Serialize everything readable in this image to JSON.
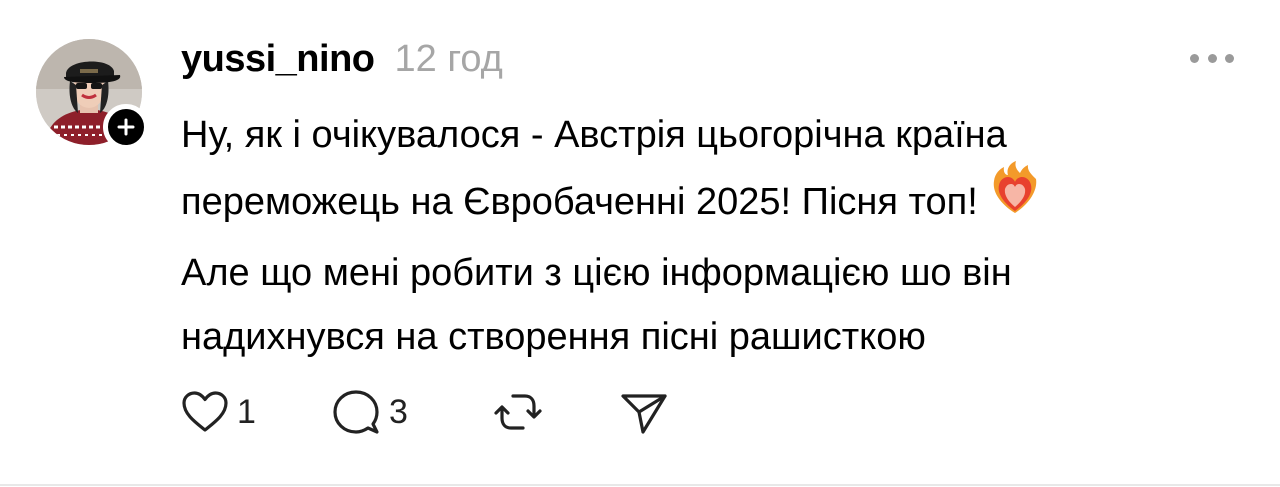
{
  "post": {
    "username": "yussi_nino",
    "timestamp": "12 год",
    "text_lines": [
      "Ну, як і очікувалося - Австрія цьогорічна країна",
      "переможець на Євробаченні 2025! Пісня топ!",
      "Але що мені робити з цією інформацією шо він",
      "надихнувся на створення пісні рашисткою"
    ],
    "emoji": "heart-on-fire-icon",
    "actions": {
      "likes": "1",
      "comments": "3"
    },
    "icons": {
      "follow": "plus-icon",
      "more": "more-options-icon",
      "like": "heart-icon",
      "comment": "comment-icon",
      "repost": "repost-icon",
      "share": "send-icon"
    },
    "colors": {
      "text": "#000000",
      "muted": "#a6a6a6",
      "icon": "#222222"
    }
  }
}
